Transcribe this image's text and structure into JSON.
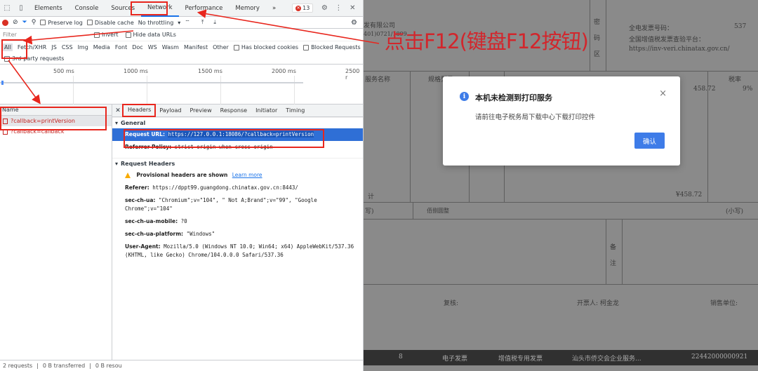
{
  "devtools": {
    "tabs": [
      "Elements",
      "Console",
      "Sources",
      "Network",
      "Performance",
      "Memory"
    ],
    "more_tabs": "»",
    "error_count": "13",
    "toolbar": {
      "preserve_log": "Preserve log",
      "disable_cache": "Disable cache",
      "throttling": "No throttling"
    },
    "filter": {
      "placeholder": "Filter",
      "invert": "Invert",
      "hide_data_urls": "Hide data URLs"
    },
    "types": [
      "All",
      "Fetch/XHR",
      "JS",
      "CSS",
      "Img",
      "Media",
      "Font",
      "Doc",
      "WS",
      "Wasm",
      "Manifest",
      "Other"
    ],
    "has_blocked_cookies": "Has blocked cookies",
    "blocked_requests": "Blocked Requests",
    "third_party": "3rd-party requests",
    "timeline_ticks": [
      "500 ms",
      "1000 ms",
      "1500 ms",
      "2000 ms",
      "2500 r"
    ],
    "name_header": "Name",
    "requests": [
      "?callback=printVersion",
      "?callback=callback"
    ],
    "detail_tabs": [
      "Headers",
      "Payload",
      "Preview",
      "Response",
      "Initiator",
      "Timing"
    ],
    "general": {
      "title": "General",
      "request_url_key": "Request URL:",
      "request_url": "https://127.0.0.1:18086/?callback=printVersion",
      "referrer_policy_key": "Referrer Policy:",
      "referrer_policy": "strict-origin-when-cross-origin"
    },
    "request_headers": {
      "title": "Request Headers",
      "provisional": "Provisional headers are shown",
      "learn_more": "Learn more",
      "referer_key": "Referer:",
      "referer": "https://dppt99.guangdong.chinatax.gov.cn:8443/",
      "sec_ch_ua_key": "sec-ch-ua:",
      "sec_ch_ua": "\"Chromium\";v=\"104\", \" Not A;Brand\";v=\"99\", \"Google Chrome\";v=\"104\"",
      "sec_ch_ua_mobile_key": "sec-ch-ua-mobile:",
      "sec_ch_ua_mobile": "?0",
      "sec_ch_ua_platform_key": "sec-ch-ua-platform:",
      "sec_ch_ua_platform": "\"Windows\"",
      "user_agent_key": "User-Agent:",
      "user_agent": "Mozilla/5.0 (Windows NT 10.0; Win64; x64) AppleWebKit/537.36 (KHTML, like Gecko) Chrome/104.0.0.0 Safari/537.36"
    },
    "status": {
      "requests": "2 requests",
      "transferred": "0 B transferred",
      "resources": "0 B resou"
    }
  },
  "invoice": {
    "company": "发有限公司",
    "id_fragment": "401)0721/1899",
    "mi": "密",
    "qu": "区",
    "ma": "码",
    "invoice_no_label": "全电发票号码：",
    "invoice_no": "537",
    "platform_label": "全国增值税发票查验平台：",
    "platform_url": "https://inv-veri.chinatax.gov.cn/",
    "item_name_col": "服务名称",
    "spec_col": "规格型号",
    "tax_rate_col": "税率",
    "amount": "458.72",
    "tax_rate": "9%",
    "total_amount": "¥458.72",
    "subtotal_label": "计",
    "capital_label": "(小写)",
    "capital_left": "写)",
    "settle_text": "佰捌圆整",
    "remark": "备",
    "remark2": "注",
    "reviewer": "复核:",
    "issuer": "开票人: 柯金龙",
    "seller": "销售单位:",
    "bottom_row": {
      "index": "8",
      "type": "电子发票",
      "subtype": "增值税专用发票",
      "org": "汕头市侨交会企业服务...",
      "number": "22442000000921"
    }
  },
  "modal": {
    "icon": "info-icon",
    "title": "本机未检测到打印服务",
    "message": "请前往电子税务局下载中心下载打印控件",
    "confirm": "确认",
    "close": "×"
  },
  "annotation": {
    "text": "点击F12(键盘F12按钮)",
    "color": "#e8261d"
  }
}
